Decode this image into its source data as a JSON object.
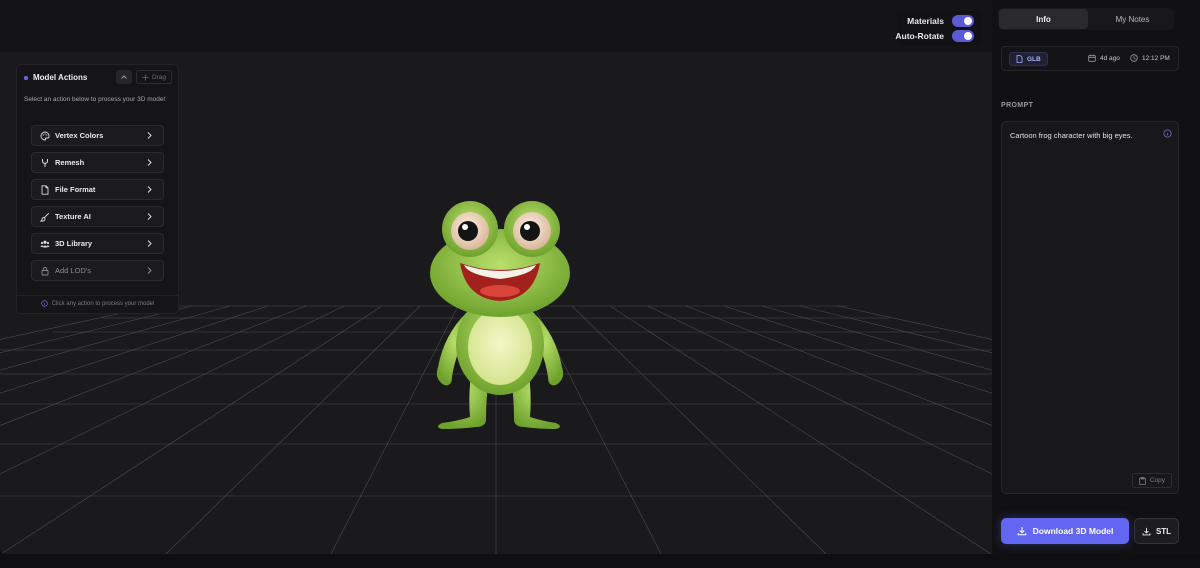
{
  "viewer": {
    "toggles": [
      {
        "label": "Materials",
        "on": true
      },
      {
        "label": "Auto-Rotate",
        "on": true
      }
    ],
    "model_icon": "frog-3d-model"
  },
  "actions_panel": {
    "title": "Model Actions",
    "drag_label": "Drag",
    "subtitle": "Select an action below to process your 3D model",
    "items": [
      {
        "label": "Vertex Colors",
        "icon": "palette-icon",
        "enabled": true
      },
      {
        "label": "Remesh",
        "icon": "fork-icon",
        "enabled": true
      },
      {
        "label": "File Format",
        "icon": "file-icon",
        "enabled": true
      },
      {
        "label": "Texture AI",
        "icon": "brush-icon",
        "enabled": true
      },
      {
        "label": "3D Library",
        "icon": "users-icon",
        "enabled": true
      },
      {
        "label": "Add LOD's",
        "icon": "lock-icon",
        "enabled": false
      }
    ],
    "footer": "Click any action to process your model"
  },
  "side_panel": {
    "tabs": [
      {
        "label": "Info",
        "active": true
      },
      {
        "label": "My Notes",
        "active": false
      }
    ],
    "format_badge": "GLB",
    "age": "4d ago",
    "time": "12:12 PM",
    "prompt_label": "PROMPT",
    "prompt_text": "Cartoon frog character with big eyes.",
    "copy_label": "Copy",
    "download_label": "Download 3D Model",
    "stl_label": "STL"
  },
  "colors": {
    "accent": "#6366f1",
    "background": "#1a1a1d",
    "panel": "#151517"
  }
}
